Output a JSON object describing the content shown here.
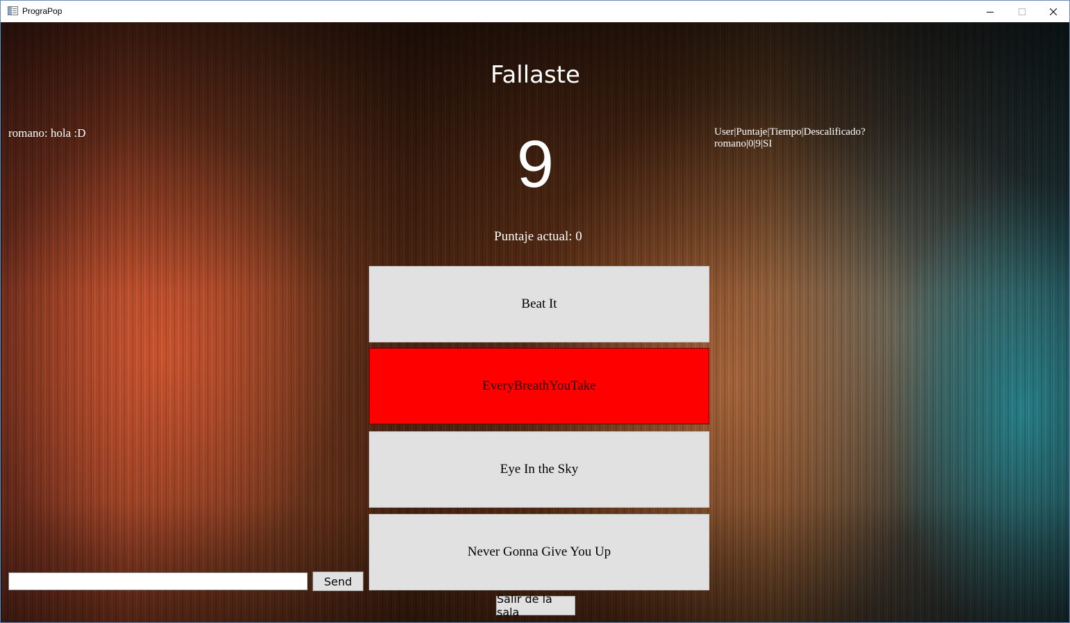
{
  "window": {
    "title": "PrograPop",
    "icon": "app-window-icon",
    "controls": [
      "minimize-icon",
      "maximize-icon",
      "close-icon"
    ]
  },
  "game": {
    "status_title": "Fallaste",
    "countdown": "9",
    "score_text": "Puntaje actual: 0",
    "answers": [
      {
        "label": "Beat It",
        "state": "normal"
      },
      {
        "label": "EveryBreathYouTake",
        "state": "wrong"
      },
      {
        "label": "Eye In the Sky",
        "state": "normal"
      },
      {
        "label": "Never Gonna Give You Up",
        "state": "normal"
      }
    ],
    "leave_label": "Salir de la sala"
  },
  "chat": {
    "messages": [
      "romano: hola :D"
    ],
    "input_value": "",
    "send_label": "Send"
  },
  "stats": {
    "header": "User|Puntaje|Tiempo|Descalificado?",
    "rows": [
      "romano|0|9|SI"
    ]
  },
  "colors": {
    "wrong_answer": "#ff0000",
    "answer_button": "#e1e1e1",
    "text_on_background": "#ffffff"
  }
}
